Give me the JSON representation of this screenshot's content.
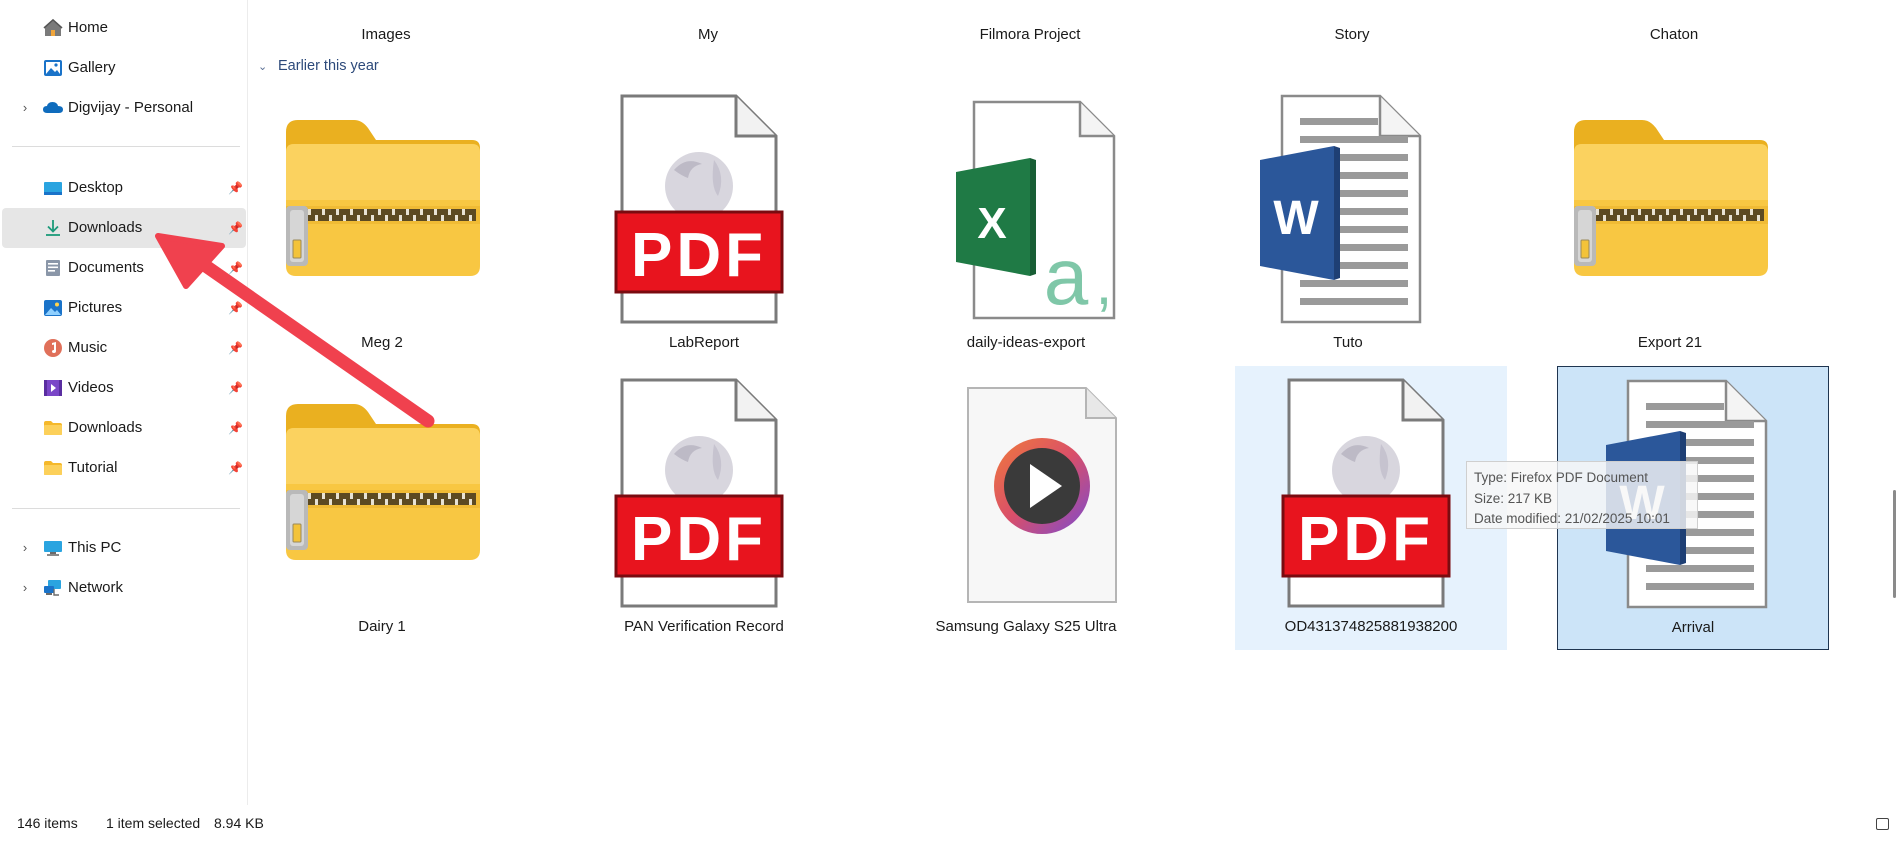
{
  "sidebar": {
    "items": [
      {
        "label": "Home",
        "icon": "home-icon"
      },
      {
        "label": "Gallery",
        "icon": "gallery-icon"
      },
      {
        "label": "Digvijay - Personal",
        "icon": "onedrive-cloud-icon"
      },
      {
        "label": "Desktop",
        "icon": "desktop-icon"
      },
      {
        "label": "Downloads",
        "icon": "download-icon"
      },
      {
        "label": "Documents",
        "icon": "documents-icon"
      },
      {
        "label": "Pictures",
        "icon": "pictures-icon"
      },
      {
        "label": "Music",
        "icon": "music-icon"
      },
      {
        "label": "Videos",
        "icon": "videos-icon"
      },
      {
        "label": "Downloads",
        "icon": "folder-icon"
      },
      {
        "label": "Tutorial",
        "icon": "folder-icon"
      },
      {
        "label": "This PC",
        "icon": "pc-icon"
      },
      {
        "label": "Network",
        "icon": "network-icon"
      }
    ],
    "selected": "Downloads"
  },
  "top_row": [
    "Images",
    "My",
    "Filmora Project",
    "Story",
    "Chaton"
  ],
  "group_header": "Earlier this year",
  "files": [
    {
      "name": "Meg 2",
      "type": "zip-folder"
    },
    {
      "name": "LabReport",
      "type": "pdf"
    },
    {
      "name": "daily-ideas-export",
      "type": "excel-csv"
    },
    {
      "name": "Tuto",
      "type": "word"
    },
    {
      "name": "Export 21",
      "type": "zip-folder"
    },
    {
      "name": "Dairy 1",
      "type": "zip-folder"
    },
    {
      "name": "PAN Verification Record",
      "type": "pdf"
    },
    {
      "name": "Samsung Galaxy S25 Ultra",
      "type": "video"
    },
    {
      "name": "OD431374825881938200",
      "type": "pdf",
      "state": "hover"
    },
    {
      "name": "Arrival",
      "type": "word",
      "state": "selected"
    }
  ],
  "tooltip": {
    "type": "Type: Firefox PDF Document",
    "size": "Size: 217 KB",
    "modified": "Date modified: 21/02/2025 10:01"
  },
  "statusbar": {
    "items_count": "146 items",
    "selection": "1 item selected",
    "size": "8.94 KB"
  },
  "colors": {
    "accent": "#1a73c9",
    "annotation_arrow": "#f0414e",
    "pdf_red": "#e8141e",
    "folder_yellow": "#f8c33f",
    "excel_green": "#1f7a45",
    "word_blue": "#2b579a"
  }
}
